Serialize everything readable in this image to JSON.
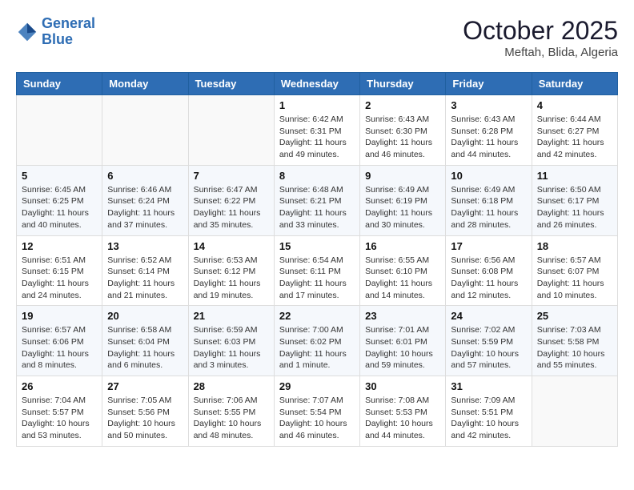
{
  "header": {
    "logo_line1": "General",
    "logo_line2": "Blue",
    "title": "October 2025",
    "subtitle": "Meftah, Blida, Algeria"
  },
  "weekdays": [
    "Sunday",
    "Monday",
    "Tuesday",
    "Wednesday",
    "Thursday",
    "Friday",
    "Saturday"
  ],
  "weeks": [
    [
      {
        "day": "",
        "info": ""
      },
      {
        "day": "",
        "info": ""
      },
      {
        "day": "",
        "info": ""
      },
      {
        "day": "1",
        "info": "Sunrise: 6:42 AM\nSunset: 6:31 PM\nDaylight: 11 hours and 49 minutes."
      },
      {
        "day": "2",
        "info": "Sunrise: 6:43 AM\nSunset: 6:30 PM\nDaylight: 11 hours and 46 minutes."
      },
      {
        "day": "3",
        "info": "Sunrise: 6:43 AM\nSunset: 6:28 PM\nDaylight: 11 hours and 44 minutes."
      },
      {
        "day": "4",
        "info": "Sunrise: 6:44 AM\nSunset: 6:27 PM\nDaylight: 11 hours and 42 minutes."
      }
    ],
    [
      {
        "day": "5",
        "info": "Sunrise: 6:45 AM\nSunset: 6:25 PM\nDaylight: 11 hours and 40 minutes."
      },
      {
        "day": "6",
        "info": "Sunrise: 6:46 AM\nSunset: 6:24 PM\nDaylight: 11 hours and 37 minutes."
      },
      {
        "day": "7",
        "info": "Sunrise: 6:47 AM\nSunset: 6:22 PM\nDaylight: 11 hours and 35 minutes."
      },
      {
        "day": "8",
        "info": "Sunrise: 6:48 AM\nSunset: 6:21 PM\nDaylight: 11 hours and 33 minutes."
      },
      {
        "day": "9",
        "info": "Sunrise: 6:49 AM\nSunset: 6:19 PM\nDaylight: 11 hours and 30 minutes."
      },
      {
        "day": "10",
        "info": "Sunrise: 6:49 AM\nSunset: 6:18 PM\nDaylight: 11 hours and 28 minutes."
      },
      {
        "day": "11",
        "info": "Sunrise: 6:50 AM\nSunset: 6:17 PM\nDaylight: 11 hours and 26 minutes."
      }
    ],
    [
      {
        "day": "12",
        "info": "Sunrise: 6:51 AM\nSunset: 6:15 PM\nDaylight: 11 hours and 24 minutes."
      },
      {
        "day": "13",
        "info": "Sunrise: 6:52 AM\nSunset: 6:14 PM\nDaylight: 11 hours and 21 minutes."
      },
      {
        "day": "14",
        "info": "Sunrise: 6:53 AM\nSunset: 6:12 PM\nDaylight: 11 hours and 19 minutes."
      },
      {
        "day": "15",
        "info": "Sunrise: 6:54 AM\nSunset: 6:11 PM\nDaylight: 11 hours and 17 minutes."
      },
      {
        "day": "16",
        "info": "Sunrise: 6:55 AM\nSunset: 6:10 PM\nDaylight: 11 hours and 14 minutes."
      },
      {
        "day": "17",
        "info": "Sunrise: 6:56 AM\nSunset: 6:08 PM\nDaylight: 11 hours and 12 minutes."
      },
      {
        "day": "18",
        "info": "Sunrise: 6:57 AM\nSunset: 6:07 PM\nDaylight: 11 hours and 10 minutes."
      }
    ],
    [
      {
        "day": "19",
        "info": "Sunrise: 6:57 AM\nSunset: 6:06 PM\nDaylight: 11 hours and 8 minutes."
      },
      {
        "day": "20",
        "info": "Sunrise: 6:58 AM\nSunset: 6:04 PM\nDaylight: 11 hours and 6 minutes."
      },
      {
        "day": "21",
        "info": "Sunrise: 6:59 AM\nSunset: 6:03 PM\nDaylight: 11 hours and 3 minutes."
      },
      {
        "day": "22",
        "info": "Sunrise: 7:00 AM\nSunset: 6:02 PM\nDaylight: 11 hours and 1 minute."
      },
      {
        "day": "23",
        "info": "Sunrise: 7:01 AM\nSunset: 6:01 PM\nDaylight: 10 hours and 59 minutes."
      },
      {
        "day": "24",
        "info": "Sunrise: 7:02 AM\nSunset: 5:59 PM\nDaylight: 10 hours and 57 minutes."
      },
      {
        "day": "25",
        "info": "Sunrise: 7:03 AM\nSunset: 5:58 PM\nDaylight: 10 hours and 55 minutes."
      }
    ],
    [
      {
        "day": "26",
        "info": "Sunrise: 7:04 AM\nSunset: 5:57 PM\nDaylight: 10 hours and 53 minutes."
      },
      {
        "day": "27",
        "info": "Sunrise: 7:05 AM\nSunset: 5:56 PM\nDaylight: 10 hours and 50 minutes."
      },
      {
        "day": "28",
        "info": "Sunrise: 7:06 AM\nSunset: 5:55 PM\nDaylight: 10 hours and 48 minutes."
      },
      {
        "day": "29",
        "info": "Sunrise: 7:07 AM\nSunset: 5:54 PM\nDaylight: 10 hours and 46 minutes."
      },
      {
        "day": "30",
        "info": "Sunrise: 7:08 AM\nSunset: 5:53 PM\nDaylight: 10 hours and 44 minutes."
      },
      {
        "day": "31",
        "info": "Sunrise: 7:09 AM\nSunset: 5:51 PM\nDaylight: 10 hours and 42 minutes."
      },
      {
        "day": "",
        "info": ""
      }
    ]
  ]
}
